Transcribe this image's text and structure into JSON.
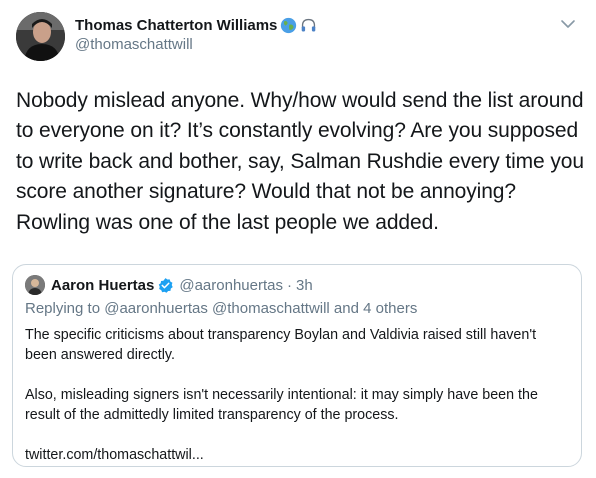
{
  "author": {
    "display_name": "Thomas Chatterton Williams",
    "handle": "@thomaschattwill",
    "name_emojis": [
      "globe-icon",
      "headphones-icon"
    ]
  },
  "tweet": {
    "text": "Nobody mislead anyone. Why/how would send the list around to everyone on it? It’s constantly evolving? Are you supposed to write back and bother, say, Salman Rushdie every time you score another signature? Would that not be annoying? Rowling was one of the last people we added."
  },
  "quoted_tweet": {
    "display_name": "Aaron Huertas",
    "handle": "@aaronhuertas",
    "separator": "·",
    "time": "3h",
    "replying_to": "Replying to @aaronhuertas @thomaschattwill and 4 others",
    "paragraph_1": "The specific criticisms about transparency Boylan and Valdivia raised still haven't been answered directly.",
    "paragraph_2": "Also, misleading signers isn't necessarily intentional: it may simply have been the result of the admittedly limited transparency of the process.",
    "link": "twitter.com/thomaschattwil..."
  },
  "colors": {
    "text": "#14171a",
    "secondary": "#657786",
    "border": "#ccd6dd",
    "verified": "#1da1f2"
  }
}
